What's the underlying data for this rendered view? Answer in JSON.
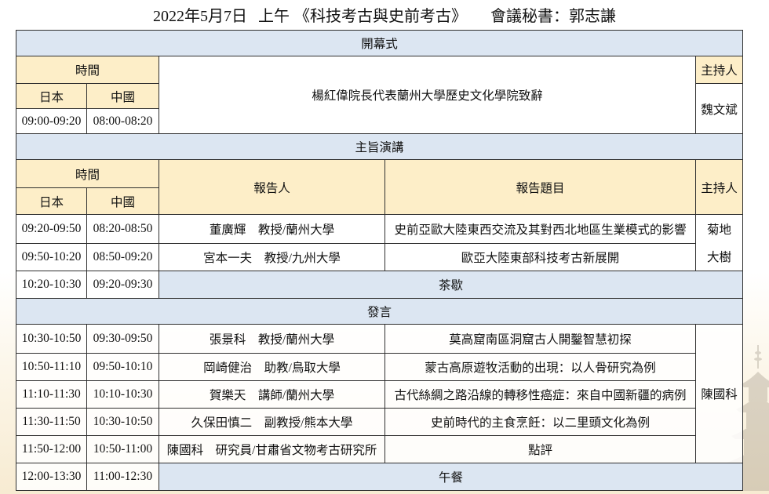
{
  "title": {
    "date": "2022年5月7日",
    "session": "上午",
    "theme": "《科技考古與史前考古》",
    "secretary": "會議秘書：郭志謙"
  },
  "labels": {
    "time": "時間",
    "japan": "日本",
    "china": "中國",
    "speaker": "報告人",
    "topic": "報告題目",
    "host": "主持人"
  },
  "opening": {
    "section": "開幕式",
    "japan_time": "09:00-09:20",
    "china_time": "08:00-08:20",
    "content": "楊紅偉院長代表蘭州大學歷史文化學院致辭",
    "host": "魏文斌"
  },
  "keynote": {
    "section": "主旨演講",
    "rows": [
      {
        "japan_time": "09:20-09:50",
        "china_time": "08:20-08:50",
        "speaker": {
          "name": "董廣輝",
          "role": "教授/蘭州大學"
        },
        "topic": "史前亞歐大陸東西交流及其對西北地區生業模式的影響"
      },
      {
        "japan_time": "09:50-10:20",
        "china_time": "08:50-09:20",
        "speaker": {
          "name": "宮本一夫",
          "role": "教授/九州大學"
        },
        "topic": "歐亞大陸東部科技考古新展開"
      }
    ],
    "host_lines": [
      "菊地",
      "大樹"
    ],
    "break": {
      "japan_time": "10:20-10:30",
      "china_time": "09:20-09:30",
      "label": "茶歇"
    }
  },
  "talks": {
    "section": "發言",
    "rows": [
      {
        "japan_time": "10:30-10:50",
        "china_time": "09:30-09:50",
        "speaker": {
          "name": "張景科",
          "role": "教授/蘭州大學"
        },
        "topic": "莫高窟南區洞窟古人開鑿智慧初探"
      },
      {
        "japan_time": "10:50-11:10",
        "china_time": "09:50-10:10",
        "speaker": {
          "name": "岡崎健治",
          "role": "助教/鳥取大學"
        },
        "topic": "蒙古高原遊牧活動的出現：以人骨研究為例"
      },
      {
        "japan_time": "11:10-11:30",
        "china_time": "10:10-10:30",
        "speaker": {
          "name": "賀樂天",
          "role": "講師/蘭州大學"
        },
        "topic": "古代絲綢之路沿線的轉移性癌症：來自中國新疆的病例"
      },
      {
        "japan_time": "11:30-11:50",
        "china_time": "10:30-10:50",
        "speaker": {
          "name": "久保田慎二",
          "role": "副教授/熊本大學"
        },
        "topic": "史前時代的主食烹飪：以二里頭文化為例"
      },
      {
        "japan_time": "11:50-12:00",
        "china_time": "10:50-11:00",
        "speaker": {
          "name": "陳國科",
          "role": "研究員/甘肅省文物考古研究所"
        },
        "topic": "點評"
      }
    ],
    "host": "陳國科",
    "lunch": {
      "japan_time": "12:00-13:30",
      "china_time": "11:00-12:30",
      "label": "午餐"
    }
  },
  "colors": {
    "section_bg": "#dce6f2",
    "label_bg": "#fdeec8",
    "border": "#2f2f2f",
    "text": "#111111"
  }
}
